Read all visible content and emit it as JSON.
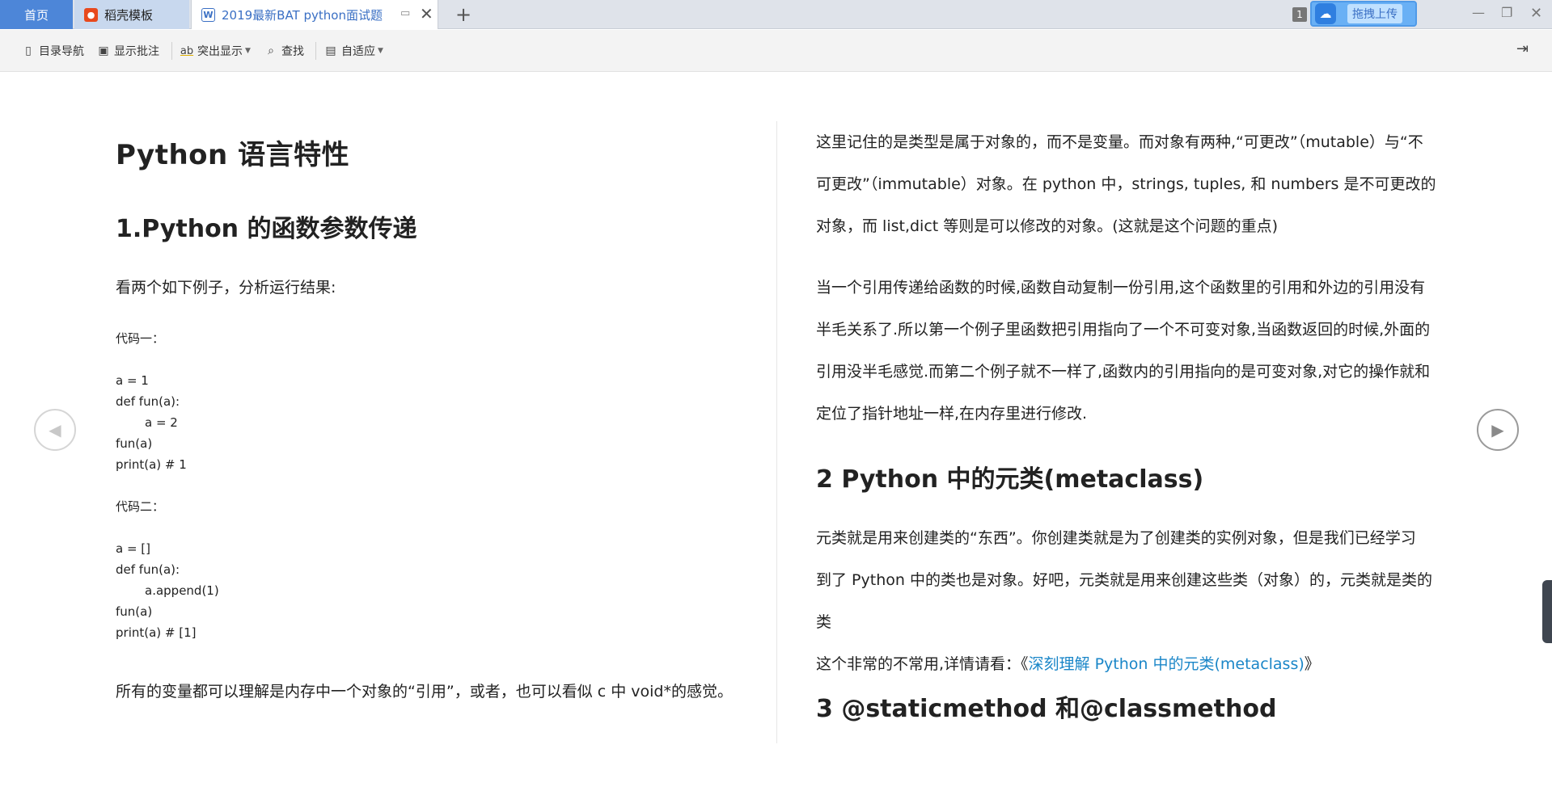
{
  "tabs": {
    "home": "首页",
    "daoke": "稻壳模板",
    "doc": "2019最新BAT python面试题",
    "doc_icon": "W",
    "add": "+"
  },
  "window": {
    "badge_count": "1",
    "upload_label": "拖拽上传",
    "upload_icon": "cloud-icon"
  },
  "toolbar": {
    "items": [
      {
        "label": "目录导航",
        "icon": "outline-icon"
      },
      {
        "label": "显示批注",
        "icon": "comment-icon"
      },
      {
        "label": "突出显示",
        "icon": "highlight-icon"
      },
      {
        "label": "查找",
        "icon": "search-icon"
      },
      {
        "label": "自适应",
        "icon": "fit-icon"
      }
    ]
  },
  "left": {
    "title": "Python 语言特性",
    "sec1": "1.Python 的函数参数传递",
    "intro": "看两个如下例子，分析运行结果:",
    "code1_label": "代码一：",
    "code1": [
      "a = 1",
      "def fun(a):",
      "a = 2",
      "fun(a)",
      "print(a)    # 1"
    ],
    "code2_label": "代码二：",
    "code2": [
      "a = []",
      "def fun(a):",
      "a.append(1)",
      "fun(a)",
      "print(a)    # [1]"
    ],
    "outro": "所有的变量都可以理解是内存中一个对象的“引用”，或者，也可以看似 c 中 void*的感觉。"
  },
  "right": {
    "p1": [
      "这里记住的是类型是属于对象的，而不是变量。而对象有两种,“可更改”（mutable）与“不",
      "可更改”（immutable）对象。在 python 中，strings, tuples, 和 numbers 是不可更改的",
      "对象，而 list,dict 等则是可以修改的对象。(这就是这个问题的重点)"
    ],
    "p2": [
      "当一个引用传递给函数的时候,函数自动复制一份引用,这个函数里的引用和外边的引用没有",
      "半毛关系了.所以第一个例子里函数把引用指向了一个不可变对象,当函数返回的时候,外面的",
      "引用没半毛感觉.而第二个例子就不一样了,函数内的引用指向的是可变对象,对它的操作就和",
      "定位了指针地址一样,在内存里进行修改."
    ],
    "sec2": "2 Python 中的元类(metaclass)",
    "p3": [
      "元类就是用来创建类的“东西”。你创建类就是为了创建类的实例对象，但是我们已经学习",
      "到了 Python 中的类也是对象。好吧，元类就是用来创建这些类（对象）的，元类就是类的",
      "类"
    ],
    "p4_prefix": "这个非常的不常用,详情请看：《",
    "p4_link": "深刻理解 Python 中的元类(metaclass)",
    "p4_suffix": "》",
    "sec3": "3 @staticmethod 和@classmethod"
  },
  "nav": {
    "prev": "◀",
    "next": "▶"
  }
}
